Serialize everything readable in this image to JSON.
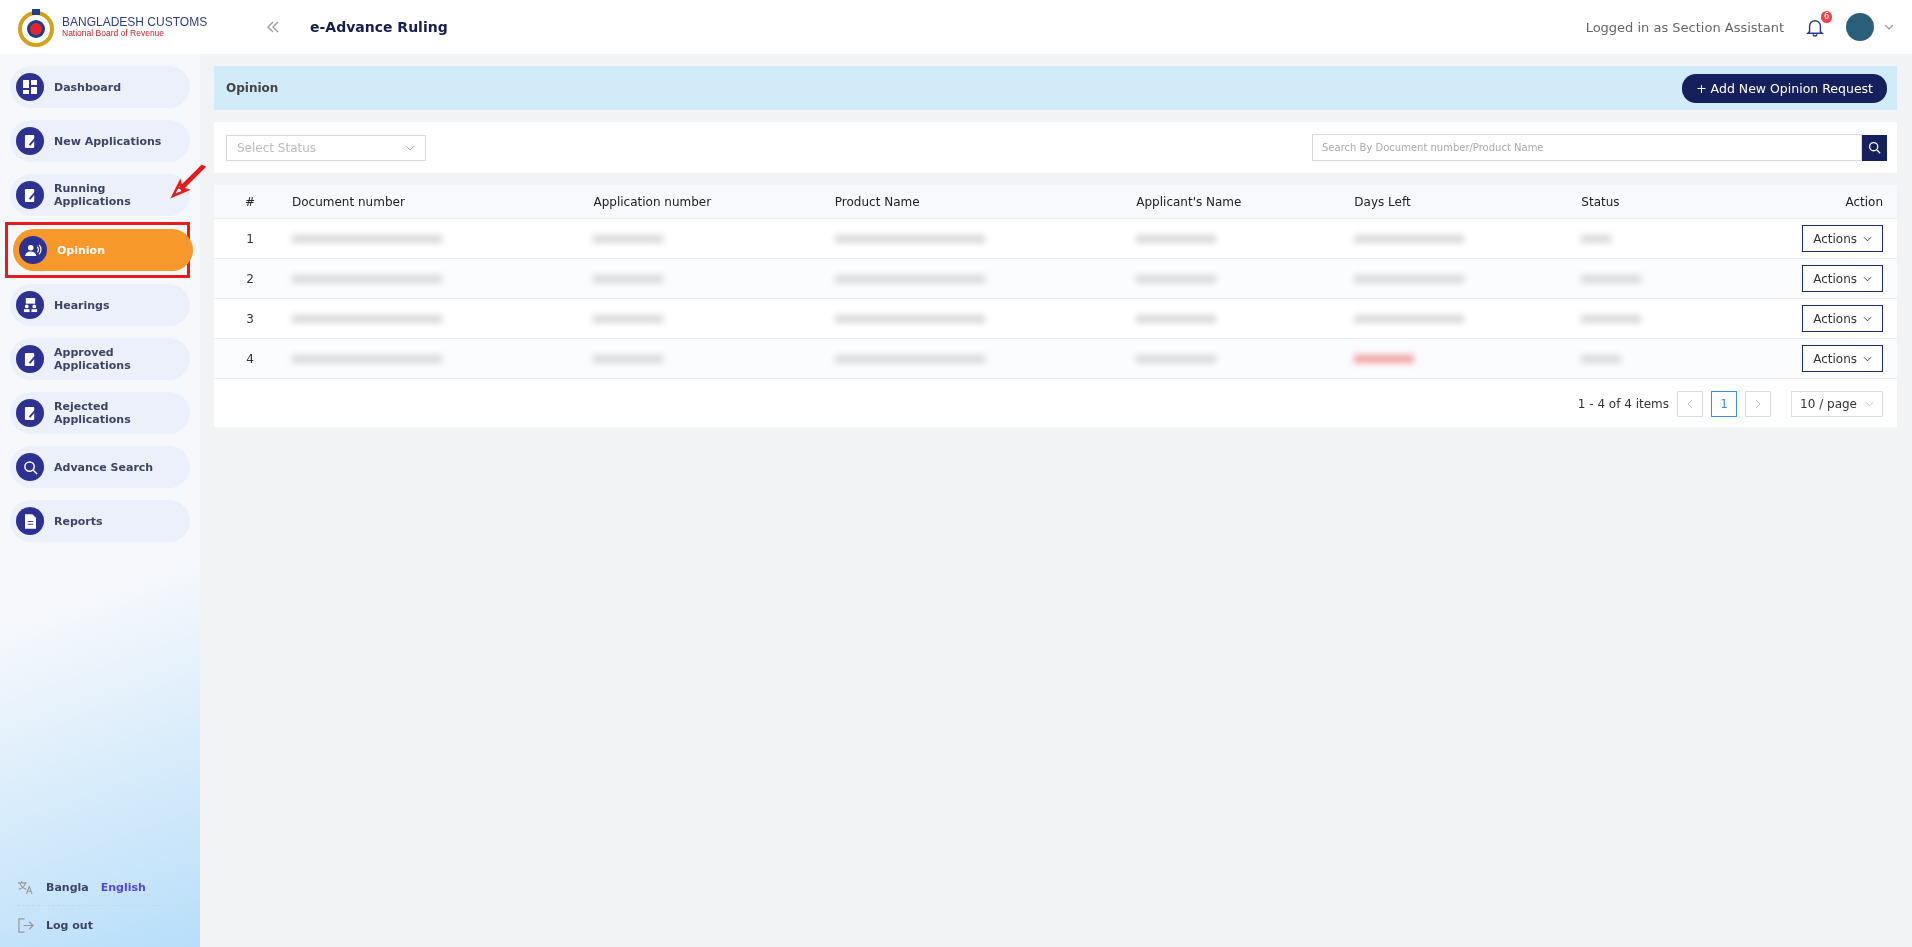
{
  "header": {
    "org_name": "BANGLADESH CUSTOMS",
    "org_subtitle": "National Board of Revenue",
    "app_title": "e-Advance Ruling",
    "user_label": "Logged in as Section Assistant",
    "notification_count": "6"
  },
  "sidebar": {
    "items": [
      {
        "label": "Dashboard",
        "selected": false
      },
      {
        "label": "New Applications",
        "selected": false
      },
      {
        "label": "Running Applications",
        "selected": false
      },
      {
        "label": "Opinion",
        "selected": true
      },
      {
        "label": "Hearings",
        "selected": false
      },
      {
        "label": "Approved Applications",
        "selected": false
      },
      {
        "label": "Rejected Applications",
        "selected": false
      },
      {
        "label": "Advance Search",
        "selected": false
      },
      {
        "label": "Reports",
        "selected": false
      }
    ],
    "languages": [
      {
        "label": "Bangla",
        "selected": false
      },
      {
        "label": "English",
        "selected": true
      }
    ],
    "logout": "Log out"
  },
  "page": {
    "title": "Opinion",
    "add_button": "+ Add New Opinion Request"
  },
  "filters": {
    "status_placeholder": "Select Status",
    "search_placeholder": "Search By Document number/Product Name"
  },
  "table": {
    "columns": [
      "#",
      "Document number",
      "Application number",
      "Product Name",
      "Applicant's Name",
      "Days Left",
      "Status",
      "Action"
    ],
    "rows": [
      {
        "number": "1",
        "days_left_overdue": false,
        "action": "Actions"
      },
      {
        "number": "2",
        "days_left_overdue": false,
        "action": "Actions"
      },
      {
        "number": "3",
        "days_left_overdue": false,
        "action": "Actions"
      },
      {
        "number": "4",
        "days_left_overdue": true,
        "action": "Actions"
      }
    ]
  },
  "pagination": {
    "summary": "1 - 4 of 4 items",
    "pages": [
      {
        "label": "1",
        "selected": true
      }
    ],
    "page_size": "10 / page"
  }
}
